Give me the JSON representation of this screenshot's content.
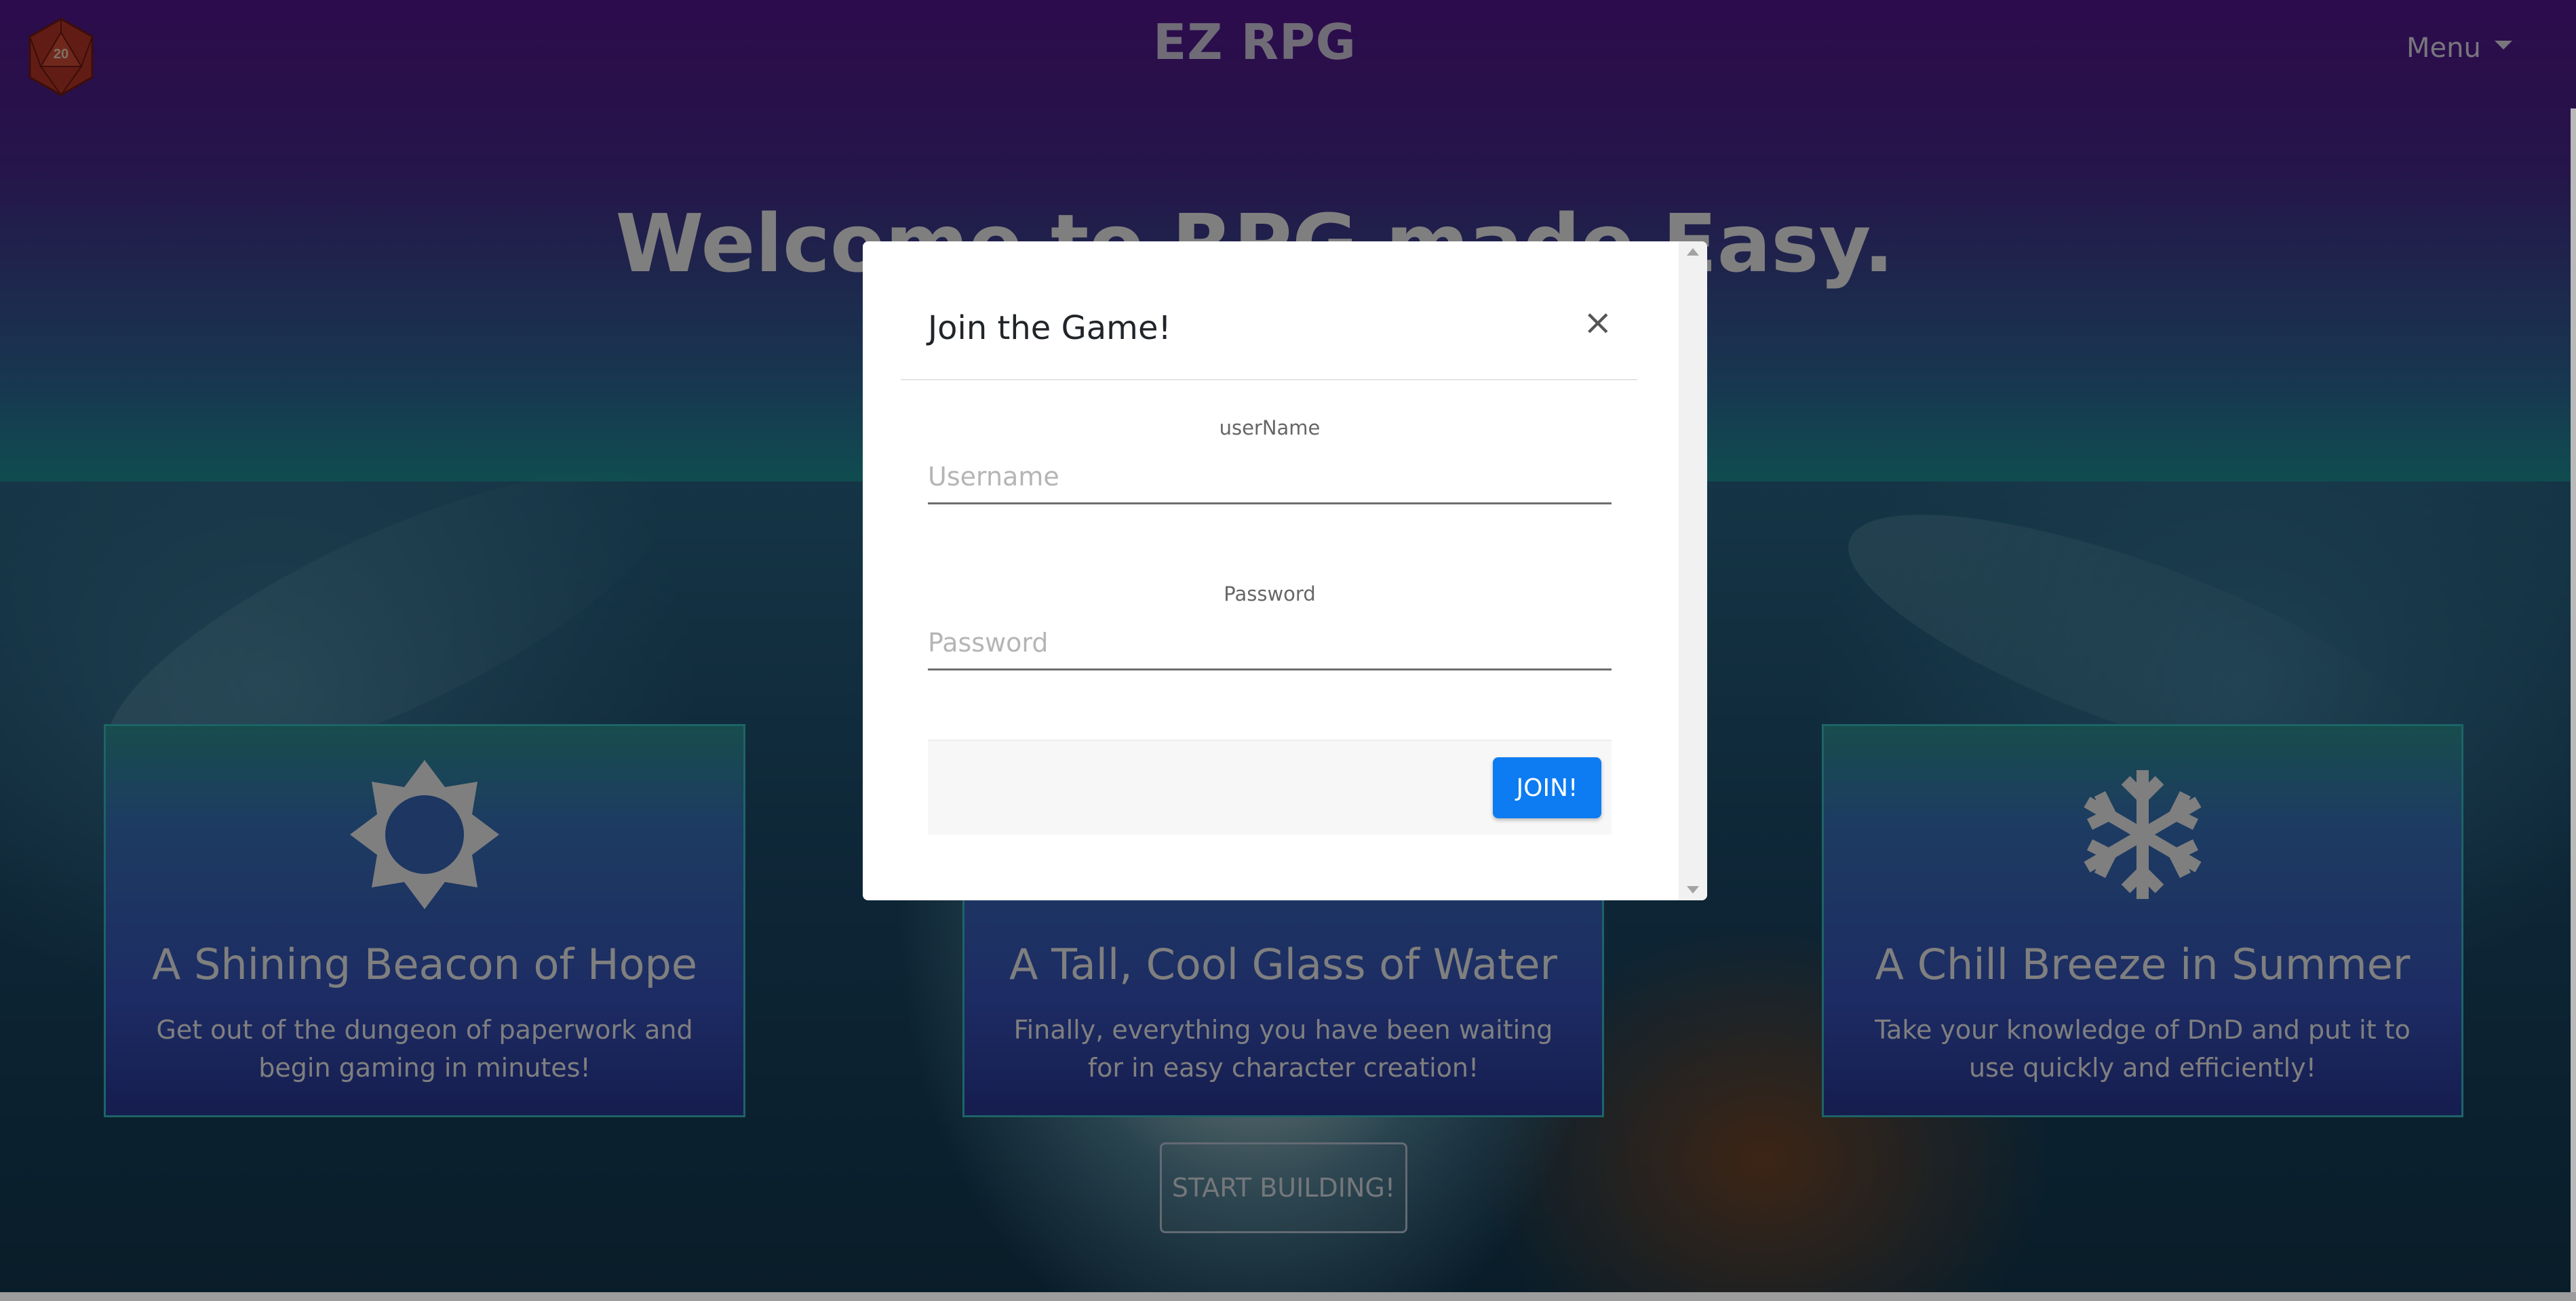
{
  "header": {
    "brand": "EZ RPG",
    "menu_label": "Menu"
  },
  "hero": {
    "title": "Welcome to RPG made Easy."
  },
  "features": [
    {
      "icon": "sun-icon",
      "title": "A Shining Beacon of Hope",
      "text": "Get out of the dungeon of paperwork and begin gaming in minutes!"
    },
    {
      "icon": "water-icon",
      "title": "A Tall, Cool Glass of Water",
      "text": "Finally, everything you have been waiting for in easy character creation!"
    },
    {
      "icon": "snowflake-icon",
      "title": "A Chill Breeze in Summer",
      "text": "Take your knowledge of DnD and put it to use quickly and efficiently!"
    }
  ],
  "cta": {
    "start_label": "START BUILDING!"
  },
  "modal": {
    "title": "Join the Game!",
    "close_glyph": "×",
    "username_label": "userName",
    "username_placeholder": "Username",
    "username_value": "",
    "password_label": "Password",
    "password_placeholder": "Password",
    "password_value": "",
    "join_label": "JOIN!"
  },
  "colors": {
    "header_top": "#5a1799",
    "join_button": "#0d7cf2",
    "card_border": "#3ac8d0"
  }
}
